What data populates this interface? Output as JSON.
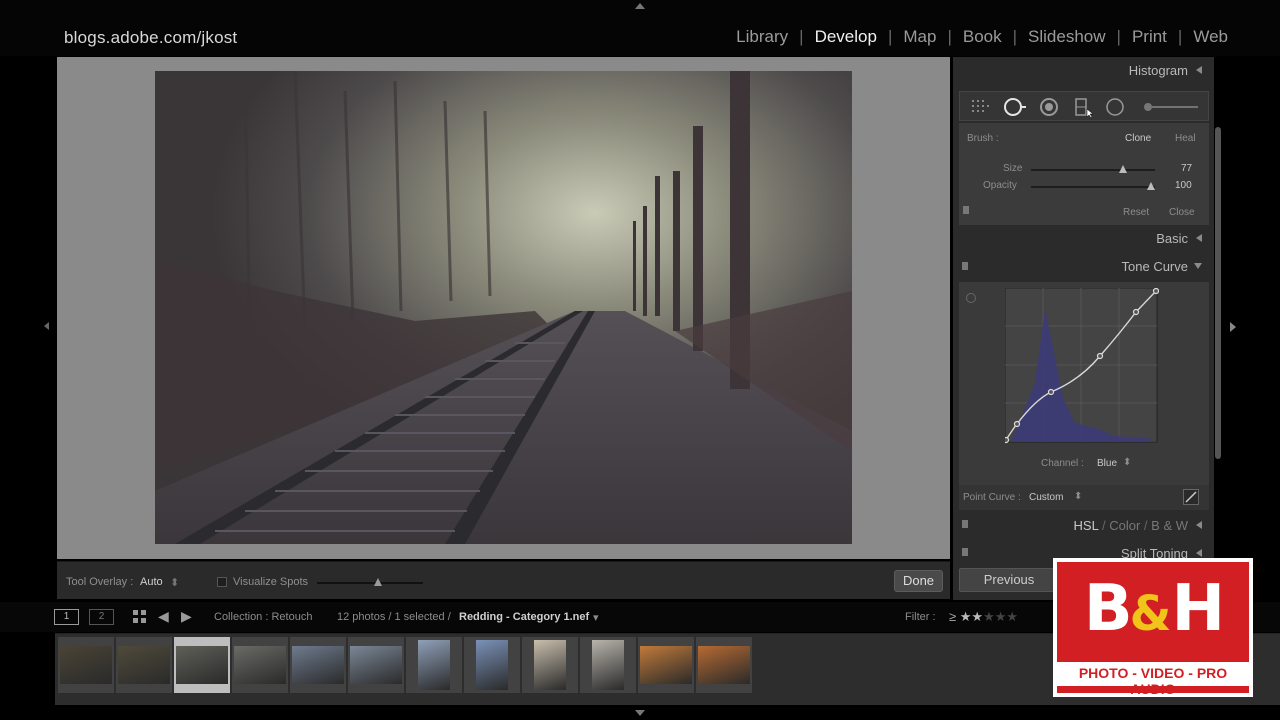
{
  "identity_plate": "blogs.adobe.com/jkost",
  "modules": [
    "Library",
    "Develop",
    "Map",
    "Book",
    "Slideshow",
    "Print",
    "Web"
  ],
  "active_module": "Develop",
  "toolbar": {
    "tool_overlay_label": "Tool Overlay :",
    "tool_overlay_value": "Auto",
    "visualize_spots_label": "Visualize Spots",
    "done_label": "Done"
  },
  "right_panel": {
    "histogram_title": "Histogram",
    "spot_removal": {
      "brush_label": "Brush :",
      "clone_label": "Clone",
      "heal_label": "Heal",
      "size_label": "Size",
      "size_value": "77",
      "opacity_label": "Opacity",
      "opacity_value": "100",
      "reset_label": "Reset",
      "close_label": "Close"
    },
    "basic_title": "Basic",
    "tone_curve_title": "Tone Curve",
    "channel_label": "Channel :",
    "channel_value": "Blue",
    "point_curve_label": "Point Curve :",
    "point_curve_value": "Custom",
    "hsl_label": "HSL",
    "color_label": "Color",
    "bw_label": "B & W",
    "split_toning_title": "Split Toning",
    "previous_label": "Previous"
  },
  "filmstrip": {
    "monitor_1": "1",
    "monitor_2": "2",
    "collection_text": "Collection : Retouch",
    "count_text": "12 photos / 1 selected /",
    "filename": "Redding - Category 1.nef",
    "filter_label": "Filter :",
    "selected_index": 2,
    "thumb_colors": [
      "#4a4436",
      "#4f4a3a",
      "#5f6058",
      "#6a6a66",
      "#6f7b8e",
      "#7b8797",
      "#8fa0b8",
      "#7a91b8",
      "#c8beac",
      "#b8b4ac",
      "#c17a3a",
      "#b66a32"
    ]
  },
  "logo": {
    "main": "B&H",
    "tagline": "PHOTO - VIDEO - PRO AUDIO"
  }
}
